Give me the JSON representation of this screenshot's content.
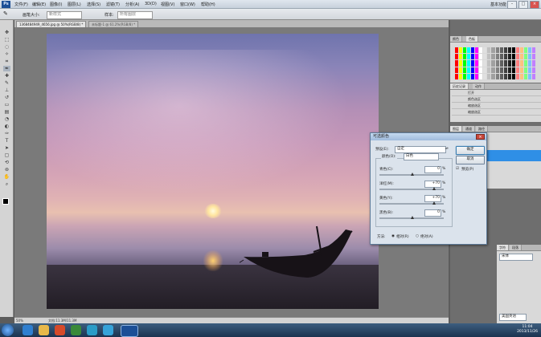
{
  "menu": {
    "logo": "Ps",
    "items": [
      "文件(F)",
      "编辑(E)",
      "图像(I)",
      "图层(L)",
      "选择(S)",
      "滤镜(T)",
      "分析(A)",
      "3D(D)",
      "视图(V)",
      "窗口(W)",
      "帮助(H)"
    ],
    "workspace": "基本功能"
  },
  "options": {
    "size_label": "画笔大小:",
    "mode_box": "新样式",
    "sample_label": "样本:",
    "sample_value": "所有图层"
  },
  "tabs": {
    "active": "1368484949_4656.jpg @ 50%(RGB/8) *",
    "second": "未标题-1 @ 61.2%(RGB/8) *"
  },
  "status": {
    "zoom": "50%",
    "doc": "文档:11.3M/11.3M"
  },
  "panels": {
    "color_tabs": [
      "颜色",
      "色板"
    ],
    "swatch_colors": [
      "#ff0000",
      "#ffff00",
      "#00ff00",
      "#00ffff",
      "#0000ff",
      "#ff00ff",
      "#ffffff",
      "#e0e0e0",
      "#c0c0c0",
      "#a0a0a0",
      "#808080",
      "#606060",
      "#404040",
      "#202020",
      "#000000",
      "#ff8080",
      "#ffc080",
      "#80ff80",
      "#80c0ff",
      "#c080ff"
    ],
    "history_tabs": [
      "历史记录",
      "动作"
    ],
    "history_items": [
      "打开",
      "颜色选区",
      "缩放选区",
      "缩放选区"
    ],
    "layers_tabs": [
      "图层",
      "通道",
      "路径"
    ],
    "char_tabs": [
      "字符",
      "段落"
    ],
    "char_font": "宋体",
    "char_lang": "美国英语"
  },
  "dialog": {
    "title": "可选颜色",
    "preset_label": "预设(E):",
    "preset_value": "自定",
    "colors_label": "颜色(O):",
    "colors_value": "白色",
    "cyan_label": "青色(C):",
    "cyan_value": "0",
    "magenta_label": "洋红(M):",
    "magenta_value": "+70",
    "yellow_label": "黄色(Y):",
    "yellow_value": "+70",
    "black_label": "黑色(B):",
    "black_value": "0",
    "percent": "%",
    "method_label": "方法:",
    "relative": "相对(R)",
    "absolute": "绝对(A)",
    "ok": "确定",
    "cancel": "取消",
    "preview": "预览(P)"
  },
  "taskbar": {
    "time": "11:04",
    "date": "2013/11/26"
  }
}
